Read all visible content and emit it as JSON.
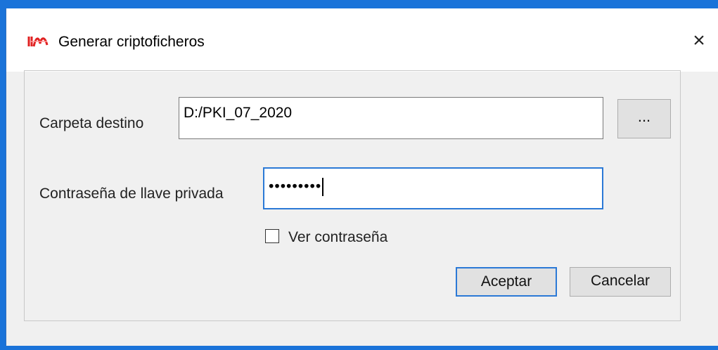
{
  "window": {
    "title": "Generar criptoficheros",
    "close_glyph": "×",
    "icon": "app-logo-icon",
    "accent_color": "#2b79d6"
  },
  "form": {
    "folder_label": "Carpeta destino",
    "folder_value": "D:/PKI_07_2020",
    "browse_label": "...",
    "password_label": "Contraseña de llave privada",
    "password_masked": "•••••••••",
    "show_password_label": "Ver contraseña",
    "show_password_checked": false
  },
  "buttons": {
    "accept": "Aceptar",
    "cancel": "Cancelar"
  }
}
